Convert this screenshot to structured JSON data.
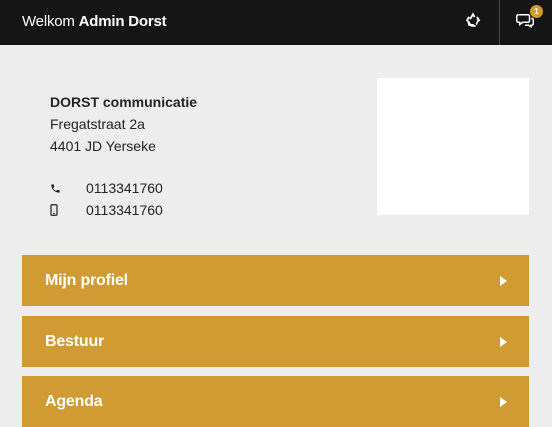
{
  "header": {
    "welcome_prefix": "Welkom",
    "welcome_name": "Admin Dorst",
    "notification_count": "1"
  },
  "contact": {
    "company": "DORST communicatie",
    "street": "Fregatstraat 2a",
    "city": "4401 JD Yerseke",
    "phone": "0113341760",
    "mobile": "0113341760"
  },
  "menu": [
    {
      "label": "Mijn profiel"
    },
    {
      "label": "Bestuur"
    },
    {
      "label": "Agenda"
    }
  ],
  "colors": {
    "topbar": "#151515",
    "accent": "#d09b33",
    "background": "#ededed"
  },
  "icons": {
    "recycle": "recycle-icon",
    "chat": "chat-icon",
    "phone": "phone-icon",
    "mobile": "mobile-icon",
    "arrow": "caret-right-icon"
  }
}
